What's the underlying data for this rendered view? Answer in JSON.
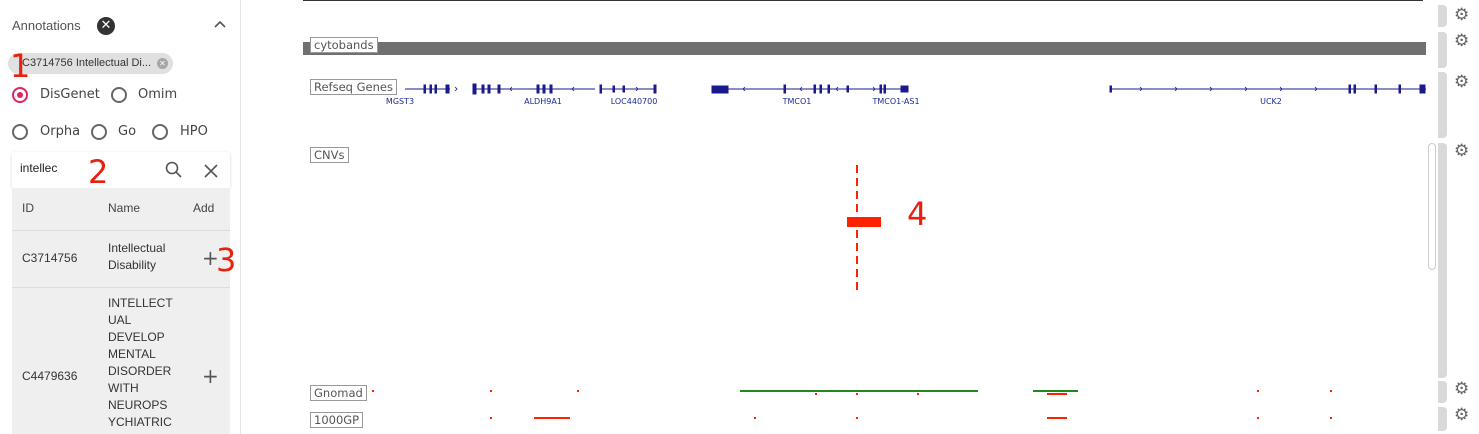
{
  "annotations": {
    "title": "Annotations",
    "chip_label": "C3714756 Intellectual Di...",
    "sources": [
      "DisGenet",
      "Omim",
      "Orpha",
      "Go",
      "HPO"
    ],
    "selected_source": "DisGenet",
    "search": {
      "value": "intellec"
    },
    "table": {
      "headers": [
        "ID",
        "Name",
        "Add"
      ],
      "rows": [
        {
          "id": "C3714756",
          "name_lines": [
            "Intellectual",
            "Disability"
          ]
        },
        {
          "id": "C4479636",
          "name_lines": [
            "INTELLECT",
            "UAL",
            "DEVELOP",
            "MENTAL",
            "DISORDER",
            "WITH",
            "NEUROPS",
            "YCHIATRIC"
          ]
        }
      ]
    }
  },
  "markers": [
    "1",
    "2",
    "3",
    "4"
  ],
  "tracks": {
    "cytobands": "cytobands",
    "refseq": "Refseq Genes",
    "cnvs": "CNVs",
    "gnomad": "Gnomad",
    "1000gp": "1000GP"
  },
  "genes": [
    "MGST3",
    "ALDH9A1",
    "LOC440700",
    "TMCO1",
    "TMCO1-AS1",
    "UCK2"
  ],
  "colors": {
    "accent": "#e0245e",
    "marker": "#e8200e",
    "gene": "#1a1a8c",
    "cnv": "#ff2200",
    "gnomad_line": "#1e8a1e",
    "cytoband": "#707070"
  },
  "icons": {
    "close": "close-circle-icon",
    "collapse": "chevron-up-icon",
    "search": "search-icon",
    "clear": "close-icon",
    "add": "plus-icon",
    "settings": "gear-icon"
  }
}
